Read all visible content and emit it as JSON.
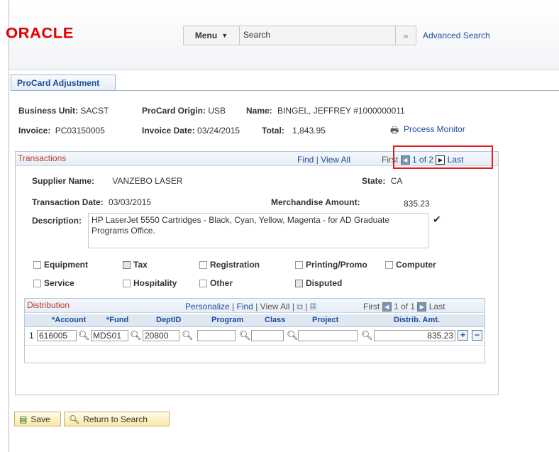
{
  "header": {
    "logo": "ORACLE",
    "menu_label": "Menu",
    "search_value": "Search",
    "go_symbol": "»",
    "advanced_search": "Advanced Search"
  },
  "tab": {
    "label": "ProCard Adjustment"
  },
  "summary": {
    "business_unit_label": "Business Unit:",
    "business_unit_value": "SACST",
    "procard_origin_label": "ProCard Origin:",
    "procard_origin_value": "USB",
    "name_label": "Name:",
    "name_value": "BINGEL, JEFFREY",
    "name_id": "#1000000011",
    "invoice_label": "Invoice:",
    "invoice_value": "PC03150005",
    "invoice_date_label": "Invoice Date:",
    "invoice_date_value": "03/24/2015",
    "total_label": "Total:",
    "total_value": "1,843.95",
    "process_monitor": "Process Monitor"
  },
  "transactions": {
    "title": "Transactions",
    "find": "Find",
    "view_all": "View All",
    "first": "First",
    "page_info": "1 of 2",
    "last": "Last",
    "supplier_label": "Supplier Name:",
    "supplier_value": "VANZEBO LASER",
    "state_label": "State:",
    "state_value": "CA",
    "trans_date_label": "Transaction Date:",
    "trans_date_value": "03/03/2015",
    "merch_label": "Merchandise Amount:",
    "merch_value": "835.23",
    "desc_label": "Description:",
    "desc_value": "HP LaserJet 5550 Cartridges - Black, Cyan, Yellow, Magenta - for AD Graduate Programs Office.",
    "checkboxes": {
      "equipment": "Equipment",
      "tax": "Tax",
      "registration": "Registration",
      "printing": "Printing/Promo",
      "computer": "Computer",
      "service": "Service",
      "hospitality": "Hospitality",
      "other": "Other",
      "disputed": "Disputed"
    }
  },
  "distribution": {
    "title": "Distribution",
    "personalize": "Personalize",
    "find": "Find",
    "view_all": "View All",
    "first": "First",
    "page_info": "1 of 1",
    "last": "Last",
    "columns": {
      "account": "*Account",
      "fund": "*Fund",
      "deptid": "DeptID",
      "program": "Program",
      "class": "Class",
      "project": "Project",
      "amount": "Distrib. Amt."
    },
    "row": {
      "num": "1",
      "account": "616005",
      "fund": "MDS01",
      "deptid": "20800",
      "program": "",
      "class": "",
      "project": "",
      "amount": "835.23",
      "add": "+",
      "remove": "−"
    }
  },
  "buttons": {
    "save": "Save",
    "return": "Return to Search"
  }
}
